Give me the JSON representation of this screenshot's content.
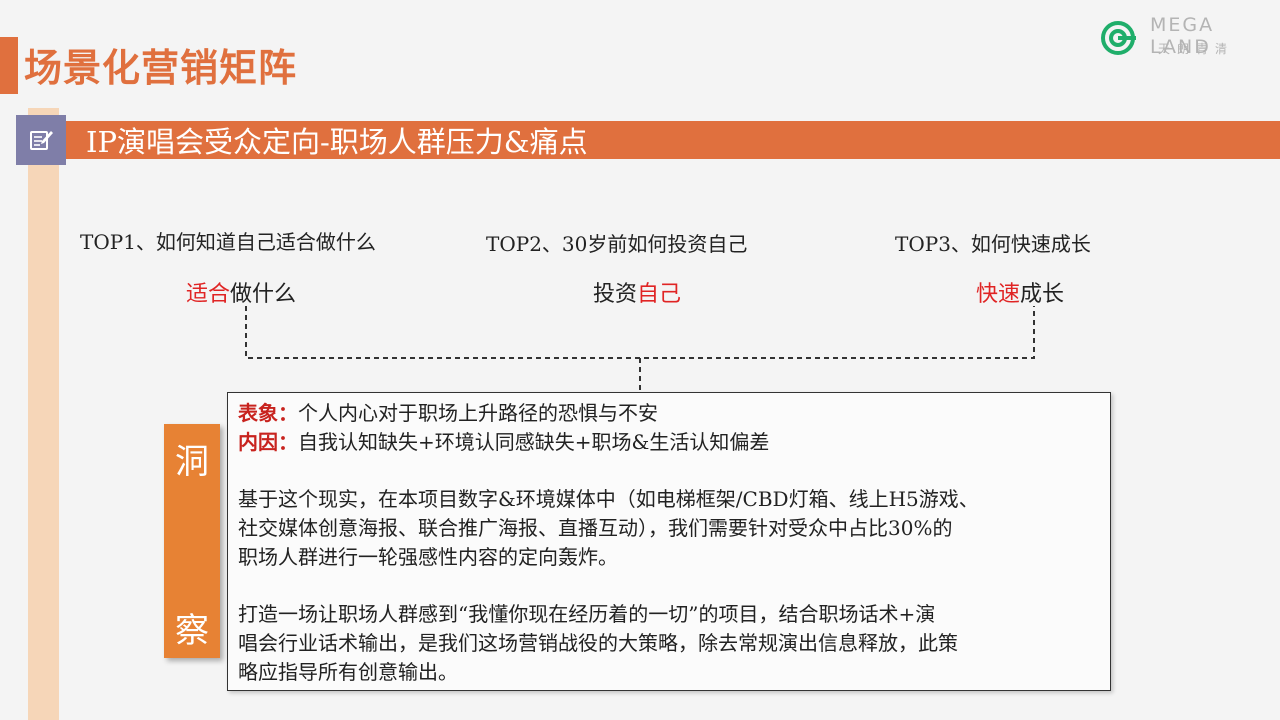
{
  "header": {
    "title": "场景化营销矩阵",
    "section_title": "IP演唱会受众定向-职场人群压力&痛点"
  },
  "logo": {
    "wordmark": "MEGA LAND",
    "cn": "天朗青清"
  },
  "tops": [
    {
      "label": "TOP1、如何知道自己适合做什么",
      "keyword_hl": "适合",
      "keyword_rest": "做什么"
    },
    {
      "label": "TOP2、30岁前如何投资自己",
      "keyword_pre": "投资",
      "keyword_hl": "自己"
    },
    {
      "label": "TOP3、如何快速成长",
      "keyword_hl": "快速",
      "keyword_rest": "成长"
    }
  ],
  "insight": {
    "tag_top": "洞",
    "tag_bottom": "察",
    "surface_label": "表象：",
    "surface_text": "个人内心对于职场上升路径的恐惧与不安",
    "inner_label": "内因：",
    "inner_text": "自我认知缺失+环境认同感缺失+职场&生活认知偏差",
    "para1_line1": "基于这个现实，在本项目数字&环境媒体中（如电梯框架/CBD灯箱、线上H5游戏、",
    "para1_line2": "社交媒体创意海报、联合推广海报、直播互动），我们需要针对受众中占比30%的",
    "para1_line3": "职场人群进行一轮强感性内容的定向轰炸。",
    "para2_line1": "打造一场让职场人群感到“我懂你现在经历着的一切”的项目，结合职场话术+演",
    "para2_line2": "唱会行业话术输出，是我们这场营销战役的大策略，除去常规演出信息释放，此策",
    "para2_line3": "略应指导所有创意输出。"
  },
  "colors": {
    "accent": "#e0703e",
    "highlight_red": "#e02424",
    "label_red": "#c8231e",
    "tag_orange": "#e78234",
    "icon_box": "#7f7ea8"
  }
}
